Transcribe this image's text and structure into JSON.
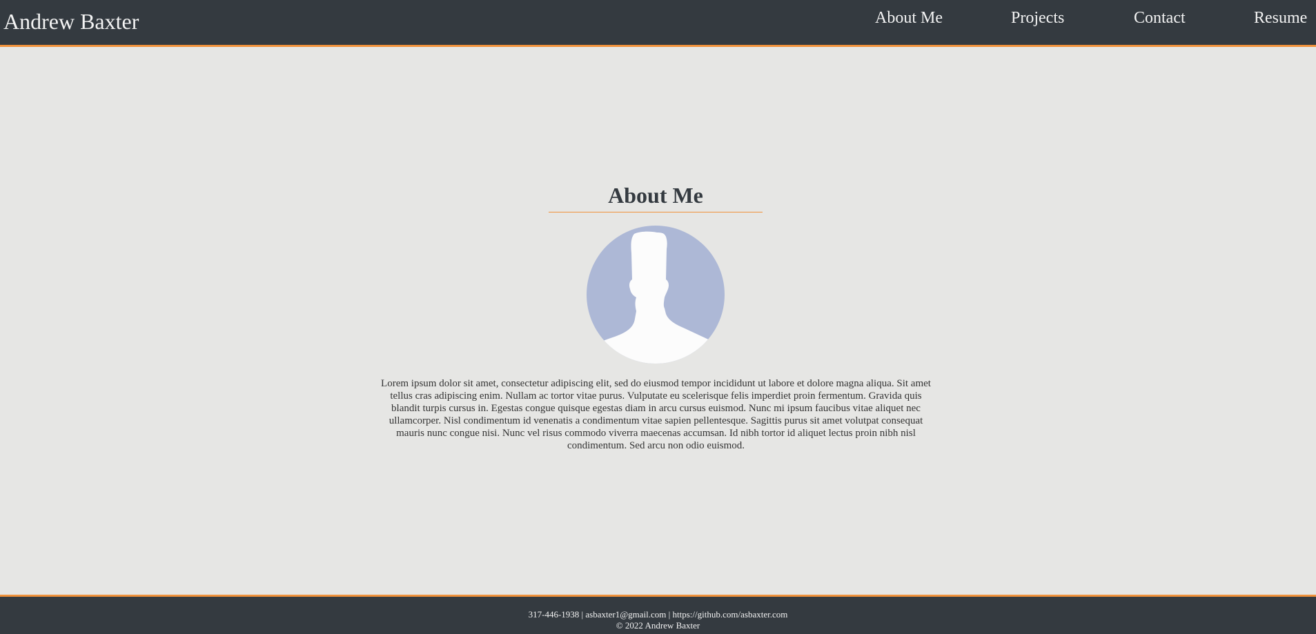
{
  "header": {
    "brand": "Andrew Baxter",
    "nav": [
      {
        "label": "About Me"
      },
      {
        "label": "Projects"
      },
      {
        "label": "Contact"
      },
      {
        "label": "Resume"
      }
    ]
  },
  "main": {
    "title": "About Me",
    "avatar_icon": "default-user-silhouette-icon",
    "bio": "Lorem ipsum dolor sit amet, consectetur adipiscing elit, sed do eiusmod tempor incididunt ut labore et dolore magna aliqua. Sit amet tellus cras adipiscing enim. Nullam ac tortor vitae purus. Vulputate eu scelerisque felis imperdiet proin fermentum. Gravida quis blandit turpis cursus in. Egestas congue quisque egestas diam in arcu cursus euismod. Nunc mi ipsum faucibus vitae aliquet nec ullamcorper. Nisl condimentum id venenatis a condimentum vitae sapien pellentesque. Sagittis purus sit amet volutpat consequat mauris nunc congue nisi. Nunc vel risus commodo viverra maecenas accumsan. Id nibh tortor id aliquet lectus proin nibh nisl condimentum. Sed arcu non odio euismod."
  },
  "footer": {
    "contact": "317-446-1938 | asbaxter1@gmail.com | https://github.com/asbaxter.com",
    "copyright": "© 2022 Andrew Baxter"
  },
  "colors": {
    "bar_background": "#343a40",
    "accent": "#f0913a",
    "page_background": "#e6e6e4",
    "avatar_background": "#adb8d6"
  }
}
